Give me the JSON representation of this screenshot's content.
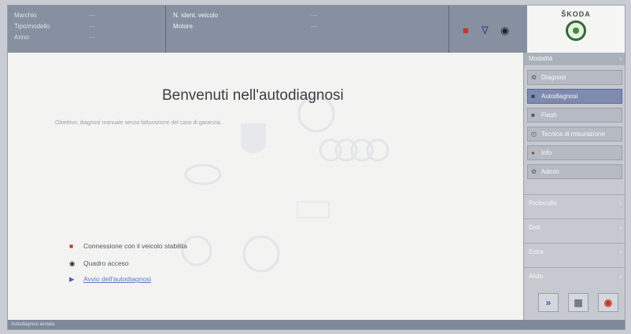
{
  "header": {
    "vehicle_rows": [
      {
        "label": "Marchio",
        "value": "---"
      },
      {
        "label": "Tipo/modello",
        "value": "---"
      },
      {
        "label": "Anno",
        "value": "---"
      }
    ],
    "info_rows": [
      {
        "label": "N. ident. veicolo",
        "value": "---"
      },
      {
        "label": "Motore",
        "value": "---"
      }
    ],
    "brand": "ŠKODA"
  },
  "main": {
    "title": "Benvenuti nell'autodiagnosi",
    "subtitle": "Obiettivo: diagnosi manuale senza fatturazione del caso di garanzia.",
    "actions": [
      {
        "icon": "car-icon",
        "label": "Connessione con il veicolo stabilita"
      },
      {
        "icon": "dashboard-icon",
        "label": "Quadro acceso"
      },
      {
        "icon": "play-icon",
        "label": "Avvio dell'autodiagnosi"
      }
    ]
  },
  "sidebar": {
    "mode_header": "Modalità",
    "mode_buttons": [
      {
        "icon": "diagnosis-icon",
        "label": "Diagnosi"
      },
      {
        "icon": "self-diagnosis-icon",
        "label": "Autodiagnosi",
        "active": true
      },
      {
        "icon": "flash-icon",
        "label": "Flash"
      },
      {
        "icon": "measuring-icon",
        "label": "Tecnica di misurazione"
      },
      {
        "icon": "info-icon",
        "label": "Info"
      },
      {
        "icon": "admin-icon",
        "label": "Admin"
      }
    ],
    "categories": [
      "Protocollo",
      "Dati",
      "Extra",
      "Aiuto"
    ]
  },
  "status_bar": "Autodiagnosi avviata",
  "colors": {
    "accent": "#7e8ab0",
    "header": "#8690a0",
    "brand_green": "#2c6e2f"
  }
}
